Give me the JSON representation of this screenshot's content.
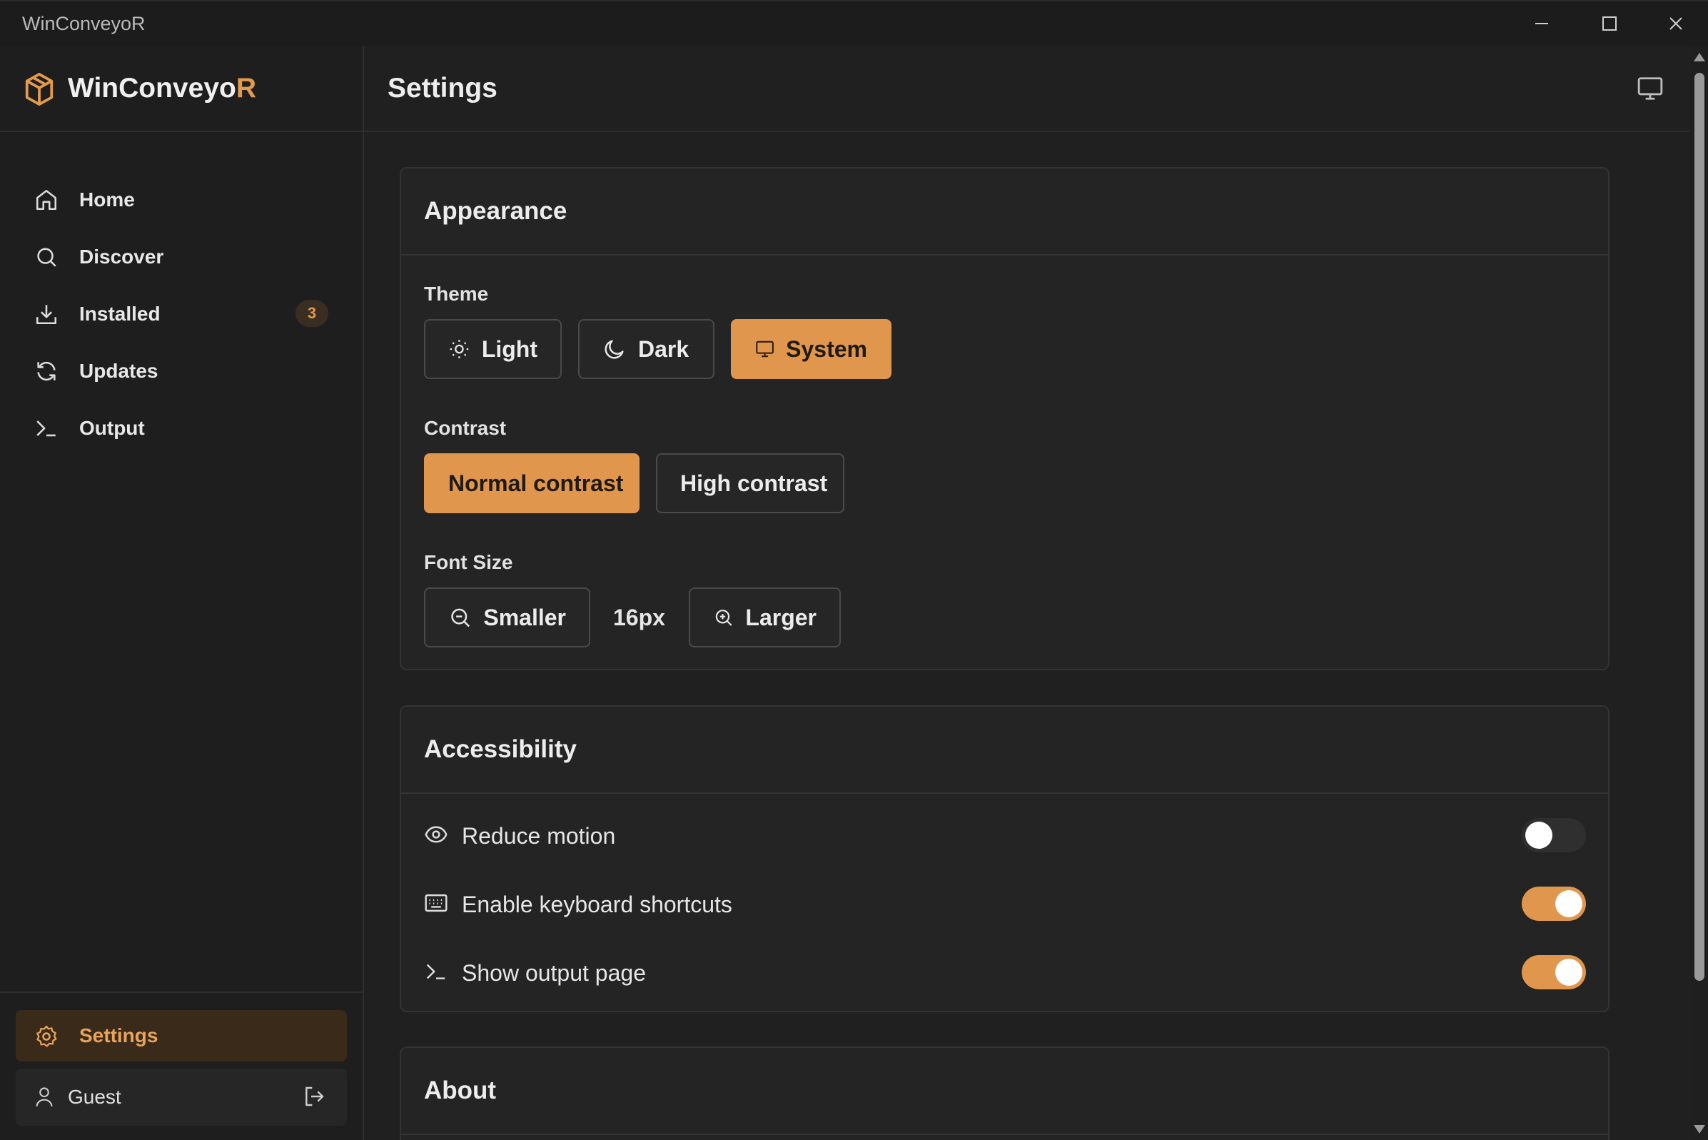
{
  "window": {
    "title": "WinConveyoR"
  },
  "brand": {
    "name_main": "WinConveyo",
    "name_accent": "R",
    "accent_color": "#e39a4c"
  },
  "sidebar": {
    "items": [
      {
        "label": "Home",
        "icon": "home-icon"
      },
      {
        "label": "Discover",
        "icon": "search-icon"
      },
      {
        "label": "Installed",
        "icon": "download-icon",
        "badge": "3"
      },
      {
        "label": "Updates",
        "icon": "refresh-icon"
      },
      {
        "label": "Output",
        "icon": "terminal-icon"
      }
    ],
    "settings_label": "Settings",
    "user_label": "Guest"
  },
  "header": {
    "title": "Settings"
  },
  "appearance": {
    "title": "Appearance",
    "theme_label": "Theme",
    "theme_options": [
      "Light",
      "Dark",
      "System"
    ],
    "theme_selected": "System",
    "contrast_label": "Contrast",
    "contrast_options": [
      "Normal contrast",
      "High contrast"
    ],
    "contrast_selected": "Normal contrast",
    "font_size_label": "Font Size",
    "smaller_label": "Smaller",
    "font_size_value": "16px",
    "larger_label": "Larger"
  },
  "accessibility": {
    "title": "Accessibility",
    "rows": [
      {
        "label": "Reduce motion",
        "icon": "eye-icon",
        "on": false
      },
      {
        "label": "Enable keyboard shortcuts",
        "icon": "keyboard-icon",
        "on": true
      },
      {
        "label": "Show output page",
        "icon": "terminal-icon",
        "on": true
      }
    ]
  },
  "about": {
    "title": "About"
  },
  "colors": {
    "accent": "#e0964c",
    "background": "#202020",
    "sidebar_active_bg": "#3a2a1a"
  }
}
